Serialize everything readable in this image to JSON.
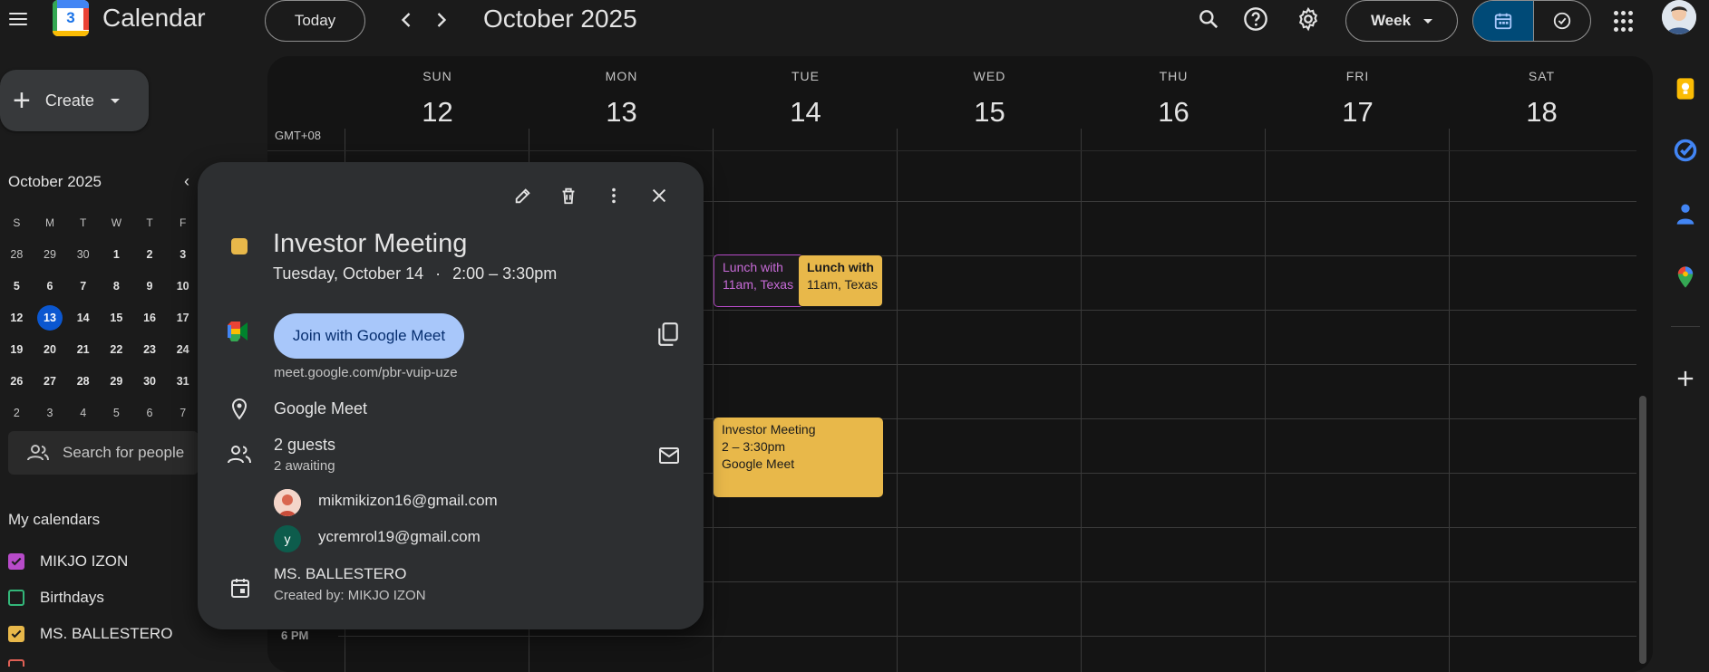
{
  "app": {
    "name": "Calendar",
    "logo_number": "3"
  },
  "toolbar": {
    "today_label": "Today",
    "month_title": "October 2025",
    "view_label": "Week",
    "prev_icon": "chevron-left-icon",
    "next_icon": "chevron-right-icon"
  },
  "sidebar": {
    "create_label": "Create",
    "mini_month": "October 2025",
    "weekday_letters": [
      "S",
      "M",
      "T",
      "W",
      "T",
      "F"
    ],
    "weeks": [
      [
        "28",
        "29",
        "30",
        "1",
        "2",
        "3"
      ],
      [
        "5",
        "6",
        "7",
        "8",
        "9",
        "10"
      ],
      [
        "12",
        "13",
        "14",
        "15",
        "16",
        "17"
      ],
      [
        "19",
        "20",
        "21",
        "22",
        "23",
        "24"
      ],
      [
        "26",
        "27",
        "28",
        "29",
        "30",
        "31"
      ],
      [
        "2",
        "3",
        "4",
        "5",
        "6",
        "7"
      ]
    ],
    "selected_day": "13",
    "search_people_placeholder": "Search for people",
    "my_calendars_title": "My calendars",
    "calendars": [
      {
        "name": "MIKJO IZON",
        "color": "#b74bc9",
        "checked": true
      },
      {
        "name": "Birthdays",
        "color": "#33b679",
        "checked": false
      },
      {
        "name": "MS. BALLESTERO",
        "color": "#e8b84a",
        "checked": true
      }
    ]
  },
  "grid": {
    "timezone": "GMT+08",
    "days": [
      {
        "name": "SUN",
        "date": "12"
      },
      {
        "name": "MON",
        "date": "13"
      },
      {
        "name": "TUE",
        "date": "14"
      },
      {
        "name": "WED",
        "date": "15"
      },
      {
        "name": "THU",
        "date": "16"
      },
      {
        "name": "FRI",
        "date": "17"
      },
      {
        "name": "SAT",
        "date": "18"
      }
    ],
    "time_label_6pm": "6 PM",
    "events": [
      {
        "title": "Lunch with",
        "time": "11am, Texas",
        "color": "#b74bc9"
      },
      {
        "title": "Lunch with",
        "time": "11am, Texas",
        "color": "#e8b84a"
      },
      {
        "title": "Investor Meeting",
        "time": "2 – 3:30pm",
        "location": "Google Meet",
        "color": "#e8b84a"
      }
    ]
  },
  "popup": {
    "title": "Investor Meeting",
    "date": "Tuesday, October 14",
    "separator": "·",
    "time": "2:00 – 3:30pm",
    "join_label": "Join with Google Meet",
    "meet_link": "meet.google.com/pbr-vuip-uze",
    "location": "Google Meet",
    "guests_count": "2 guests",
    "awaiting": "2 awaiting",
    "guests": [
      {
        "email": "mikmikizon16@gmail.com",
        "initial": ""
      },
      {
        "email": "ycremrol19@gmail.com",
        "initial": "y"
      }
    ],
    "calendar_owner": "MS. BALLESTERO",
    "created_by": "Created by: MIKJO IZON",
    "color": "#e8b84a"
  }
}
